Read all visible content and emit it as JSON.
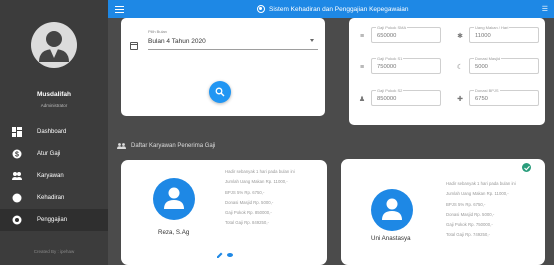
{
  "app": {
    "title": "Sistem Kehadiran dan Penggajian Kepegawaian"
  },
  "user": {
    "name": "Musdalifah",
    "role": "Administrator"
  },
  "sidebar": {
    "items": [
      {
        "label": "Dashboard",
        "icon": "dashboard-icon",
        "active": false
      },
      {
        "label": "Atur Gaji",
        "icon": "money-icon",
        "active": false
      },
      {
        "label": "Karyawan",
        "icon": "people-icon",
        "active": false
      },
      {
        "label": "Kehadiran",
        "icon": "attendance-icon",
        "active": false
      },
      {
        "label": "Penggajian",
        "icon": "payroll-icon",
        "active": true
      }
    ],
    "footer": "Created By : ipehaw"
  },
  "filter": {
    "label": "Pilih Bulan",
    "value": "Bulan 4 Tahun 2020"
  },
  "salary_settings": {
    "gaji_pokok_s1a": {
      "label": "Gaji Pokok SMA",
      "value": "650000"
    },
    "uang_makan": {
      "label": "Uang Makan / Hari",
      "value": "11000"
    },
    "gaji_pokok_s1": {
      "label": "Gaji Pokok S1",
      "value": "750000"
    },
    "donasi_masjid": {
      "label": "Donasi Masjid",
      "value": "5000"
    },
    "gaji_pokok_s2": {
      "label": "Gaji Pokok S2",
      "value": "850000"
    },
    "donasi_bpjs": {
      "label": "Donasi BPJS",
      "value": "6750"
    }
  },
  "section": {
    "title": "Daftar Karyawan Penerima Gaji"
  },
  "employees": [
    {
      "name": "Reza, S.Ag",
      "lines": [
        "Hadir sebanyak 1 hari pada bulan ini",
        "Jumlah Uang Makan Rp. 11000,-",
        "BPJS 5% Rp. 6750,-",
        "Donasi Masjid Rp. 5000,-",
        "Gaji Pokok Rp. 850000,-",
        "Total Gaji Rp. 849250,-"
      ]
    },
    {
      "name": "Uni Anastasya",
      "lines": [
        "Hadir sebanyak 1 hari pada bulan ini",
        "Jumlah Uang Makan Rp. 11000,-",
        "BPJS 5% Rp. 6750,-",
        "Donasi Masjid Rp. 5000,-",
        "Gaji Pokok Rp. 750000,-",
        "Total Gaji Rp. 749250,-"
      ]
    }
  ],
  "colors": {
    "topbar": "#1e88e5",
    "sidebar": "#3c3c3c",
    "avatar": "#1e88e5",
    "check": "#2a9d7c"
  }
}
